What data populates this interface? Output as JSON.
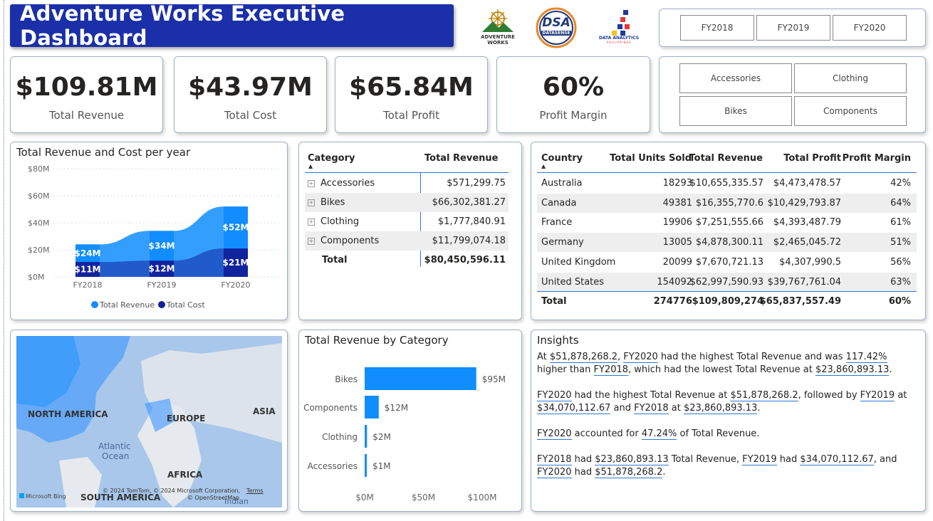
{
  "header": {
    "title": "Adventure Works Executive Dashboard"
  },
  "logos": {
    "adventure_works": "ADVENTURE WORKS",
    "dsa": "DSA",
    "dsa_sub": "DATASENSE",
    "daph": "DATA ANALYTICS",
    "daph_sub": "PHILIPPINES"
  },
  "year_slicer": [
    "FY2018",
    "FY2019",
    "FY2020"
  ],
  "category_slicer": [
    "Accessories",
    "Clothing",
    "Bikes",
    "Components"
  ],
  "kpis": [
    {
      "value": "$109.81M",
      "label": "Total Revenue"
    },
    {
      "value": "$43.97M",
      "label": "Total Cost"
    },
    {
      "value": "$65.84M",
      "label": "Total Profit"
    },
    {
      "value": "60%",
      "label": "Profit Margin"
    }
  ],
  "area_chart": {
    "title": "Total Revenue and Cost per year",
    "y_ticks": [
      "$80M",
      "$60M",
      "$40M",
      "$20M",
      "$0M"
    ],
    "legend": [
      "Total Revenue",
      "Total Cost"
    ],
    "colors": {
      "revenue": "#118dff",
      "cost": "#12239e"
    }
  },
  "category_table": {
    "headers": [
      "Category",
      "Total Revenue"
    ],
    "rows": [
      {
        "name": "Accessories",
        "value": "$571,299.75"
      },
      {
        "name": "Bikes",
        "value": "$66,302,381.27"
      },
      {
        "name": "Clothing",
        "value": "$1,777,840.91"
      },
      {
        "name": "Components",
        "value": "$11,799,074.18"
      }
    ],
    "total": {
      "name": "Total",
      "value": "$80,450,596.11"
    }
  },
  "country_table": {
    "headers": [
      "Country",
      "Total Units Sold",
      "Total Revenue",
      "Total Profit",
      "Profit Margin"
    ],
    "rows": [
      [
        "Australia",
        "18293",
        "$10,655,335.57",
        "$4,473,478.57",
        "42%"
      ],
      [
        "Canada",
        "49381",
        "$16,355,770.6",
        "$10,429,793.87",
        "64%"
      ],
      [
        "France",
        "19906",
        "$7,251,555.66",
        "$4,393,487.79",
        "61%"
      ],
      [
        "Germany",
        "13005",
        "$4,878,300.11",
        "$2,465,045.72",
        "51%"
      ],
      [
        "United Kingdom",
        "20099",
        "$7,670,721.13",
        "$4,307,990.5",
        "56%"
      ],
      [
        "United States",
        "154092",
        "$62,997,590.93",
        "$39,767,761.04",
        "63%"
      ]
    ],
    "total": [
      "Total",
      "274776",
      "$109,809,274",
      "$65,837,557.49",
      "60%"
    ]
  },
  "map": {
    "labels": [
      "NORTH AMERICA",
      "EUROPE",
      "ASIA",
      "Atlantic",
      "Ocean",
      "AFRICA",
      "SOUTH AMERICA",
      "Indian"
    ],
    "attribution": "© 2024 TomTom, © 2024 Microsoft Corporation,",
    "terms": "Terms",
    "osm": "© OpenStreetMap",
    "bing": "Microsoft Bing"
  },
  "bar_chart": {
    "title": "Total Revenue by Category",
    "x_ticks": [
      "$0M",
      "$50M",
      "$100M"
    ]
  },
  "insights": {
    "title": "Insights",
    "paragraphs": [
      "At $51,878,268.2, FY2020 had the highest Total Revenue and was 117.42% higher than FY2018, which had the lowest Total Revenue at $23,860,893.13.",
      "FY2020 had the highest Total Revenue at $51,878,268.2, followed by FY2019 at $34,070,112.67 and FY2018 at $23,860,893.13.",
      "FY2020 accounted for 47.24% of Total Revenue.",
      "FY2018 had $23,860,893.13 Total Revenue, FY2019 had $34,070,112.67, and FY2020 had $51,878,268.2."
    ]
  },
  "chart_data": [
    {
      "type": "area",
      "title": "Total Revenue and Cost per year",
      "categories": [
        "FY2018",
        "FY2019",
        "FY2020"
      ],
      "series": [
        {
          "name": "Total Revenue",
          "values": [
            24,
            34,
            52
          ],
          "labels": [
            "$24M",
            "$34M",
            "$52M"
          ]
        },
        {
          "name": "Total Cost",
          "values": [
            11,
            12,
            21
          ],
          "labels": [
            "$11M",
            "$12M",
            "$21M"
          ]
        }
      ],
      "ylim": [
        0,
        80
      ],
      "y_unit": "$M",
      "grid": true,
      "legend": "bottom"
    },
    {
      "type": "bar",
      "title": "Total Revenue by Category",
      "orientation": "horizontal",
      "categories": [
        "Bikes",
        "Components",
        "Clothing",
        "Accessories"
      ],
      "values": [
        95,
        12,
        2,
        1
      ],
      "labels": [
        "$95M",
        "$12M",
        "$2M",
        "$1M"
      ],
      "xlim": [
        0,
        110
      ],
      "x_unit": "$M"
    }
  ]
}
